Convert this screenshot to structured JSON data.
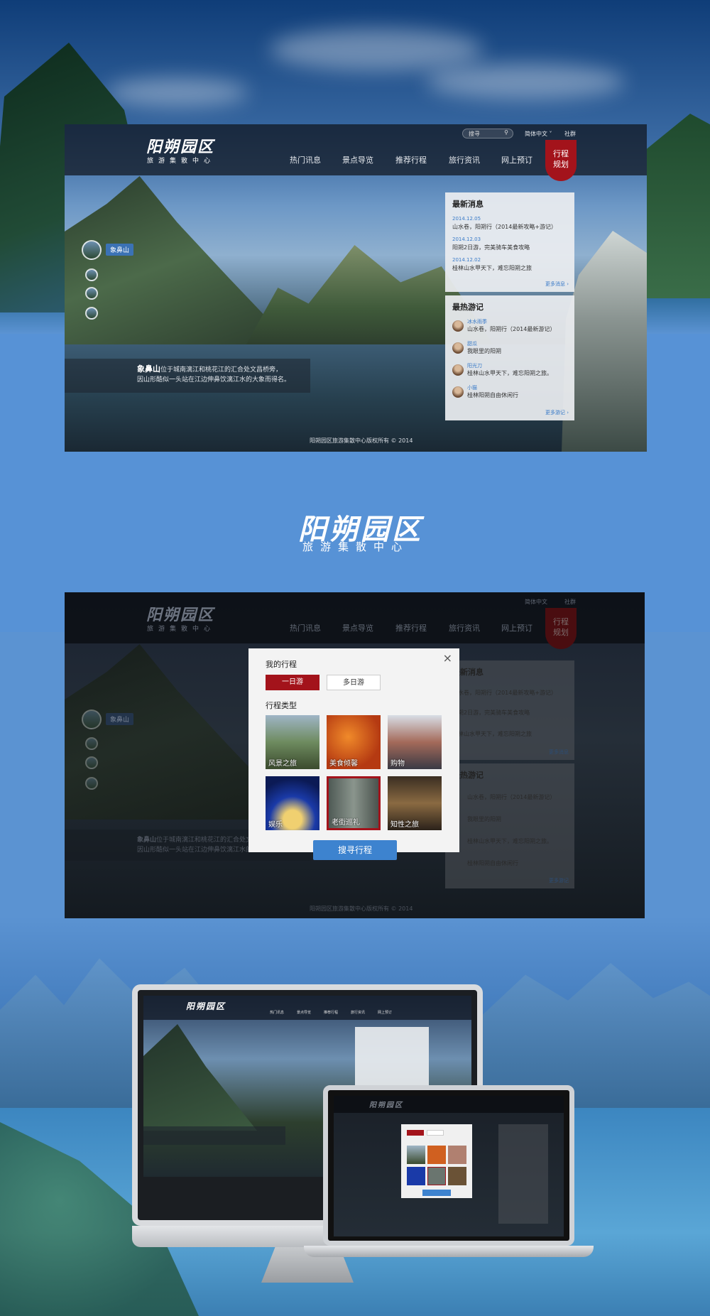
{
  "brand": {
    "title": "阳朔园区",
    "subtitle": "旅游集散中心"
  },
  "header": {
    "search_placeholder": "搜寻",
    "language": "简体中文",
    "community": "社群",
    "nav": [
      "热门讯息",
      "景点导览",
      "推荐行程",
      "旅行资讯",
      "网上预订"
    ],
    "cta_line1": "行程",
    "cta_line2": "规划"
  },
  "hero": {
    "active_spot": "象鼻山",
    "caption_title": "象鼻山",
    "caption_line1": "位于城南漓江和桃花江的汇合处文昌桥旁，",
    "caption_line2": "因山形酷似一头站在江边伸鼻饮漓江水的大象而得名。"
  },
  "news": {
    "heading": "最新消息",
    "items": [
      {
        "date": "2014.12.05",
        "text": "山水卷，阳朔行（2014最新攻略+游记）"
      },
      {
        "date": "2014.12.03",
        "text": "阳朔2日游，完美骑车美食攻略"
      },
      {
        "date": "2014.12.02",
        "text": "桂林山水甲天下，难忘阳朔之旅"
      }
    ],
    "more": "更多消息"
  },
  "travelogues": {
    "heading": "最热游记",
    "items": [
      {
        "author": "冰水雨季",
        "text": "山水卷，阳朔行（2014最新游记）"
      },
      {
        "author": "甜瓜",
        "text": "我眼里的阳朔"
      },
      {
        "author": "阳光刀",
        "text": "桂林山水甲天下，难忘阳朔之旅。"
      },
      {
        "author": "小猫",
        "text": "桂林阳朔自由休闲行"
      }
    ],
    "more": "更多游记"
  },
  "footer": {
    "copyright": "阳朔园区旅游集散中心版权所有 © 2014"
  },
  "modal": {
    "title": "我的行程",
    "close": "×",
    "tab_one_day": "一日游",
    "tab_multi_day": "多日游",
    "type_heading": "行程类型",
    "categories": [
      "风景之旅",
      "美食倾馨",
      "购物",
      "娱乐",
      "老街巡礼",
      "知性之旅"
    ],
    "search_button": "搜寻行程"
  },
  "colors": {
    "accent_red": "#a3131b",
    "accent_blue": "#3d83cf",
    "link_blue": "#3a7bc8"
  }
}
